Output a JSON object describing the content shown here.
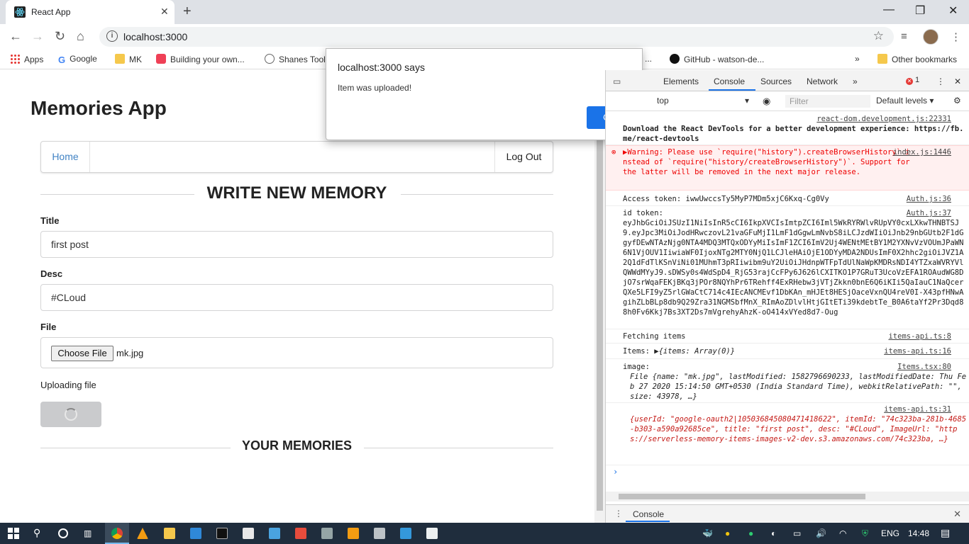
{
  "browser": {
    "tab_title": "React App",
    "url": "localhost:3000",
    "bookmarks": [
      "Apps",
      "Google",
      "MK",
      "Building your own...",
      "Shanes Tool",
      "...",
      "GitHub - watson-de...",
      "Other bookmarks"
    ]
  },
  "alert": {
    "title": "localhost:3000 says",
    "message": "Item was uploaded!",
    "ok_label": "OK"
  },
  "app": {
    "title": "Memories App",
    "menu": {
      "home": "Home",
      "logout": "Log Out"
    },
    "form_header": "WRITE NEW MEMORY",
    "title_label": "Title",
    "title_value": "first post",
    "desc_label": "Desc",
    "desc_value": "#CLoud",
    "file_label": "File",
    "file_button": "Choose File",
    "file_name": "mk.jpg",
    "status": "Uploading file",
    "memories_header": "YOUR MEMORIES"
  },
  "devtools": {
    "tabs": [
      "Elements",
      "Console",
      "Sources",
      "Network"
    ],
    "error_count": "1",
    "context": "top",
    "filter_placeholder": "Filter",
    "levels": "Default levels",
    "drawer_tab": "Console",
    "messages": {
      "m1_src": "react-dom.development.js:22331",
      "m1_text": "Download the React DevTools for a better development experience: https://fb.me/react-devtools",
      "m2_src": "index.js:1446",
      "m2_text": "▶Warning: Please use `require(\"history\").createBrowserHistory` instead of `require(\"history/createBrowserHistory\")`. Support for the latter will be removed in the next major release.",
      "m3_src": "Auth.js:36",
      "m3_text": "Access token:  iwwUwccsTy5MyP7MDm5xjC6Kxq-Cg0Vy",
      "m4_src": "Auth.js:37",
      "m4_label": "id token:",
      "m4_text": "eyJhbGciOiJSUzI1NiIsInR5cCI6IkpXVCIsImtpZCI6Iml5WkRYRWlvRUpVY0cxLXkwTHNBTSJ9.eyJpc3MiOiJodHRwczovL21vaGFuMjI1LmF1dGgwLmNvbS8iLCJzdWIiOiJnb29nbGUtb2F1dGgyfDEwNTAzNjg0NTA4MDQ3MTQxODYyMiIsImF1ZCI6ImV2Uj4WENtMEtBY1M2YXNvVzVOUmJPaWN6N1VjOUV1IiwiaWF0IjoxNTg2MTY0NjQ1LCJleHAiOjE1ODYyMDA2NDUsImF0X2hhc2giOiJVZ1A2Q1dFdTlKSnViNi01MUhmT3pRIiwibm9uY2UiOiJHdnpWTFpTdUlNaWpKMDRsNDI4YTZxaWVRYVlQWWdMYyJ9.sDWSy0s4WdSpD4_RjG53rajCcFPy6J626lCXITKO1P7GRuT3UcoVzEFA1ROAudWG8DjO7srWqaFEKjBKq3jPOr8NQYhPr6TRehff4ExRHebw3jVTjZkkn0bnE6Q6iKIi5QaIauC1NaQcerQXe5LFI9yZ5rlGWaCtC714c4IEcANCMEvf1DbKAn_mHJEt8HESjOaceVxnQU4reV0I-X43pfHNwAgihZLbBLp8db9Q29Zra31NGMSbfMnX_RImAoZDlvlHtjGItETi39kdebtTe_B0A6taYf2Pr3Dqd88h0Fv6Kkj7Bs3XT2Ds7mVgrehyAhzK-oO414xVYed8d7-Oug",
      "m5_src": "items-api.ts:8",
      "m5_text": "Fetching items",
      "m6_src": "items-api.ts:16",
      "m6_label": "Items: ",
      "m6_text": "▶{items: Array(0)}",
      "m7_src": "Items.tsx:80",
      "m7_label": "image:",
      "m7_text": "File {name: \"mk.jpg\", lastModified: 1582796690233, lastModifiedDate: Thu Feb 27 2020 15:14:50 GMT+0530 (India Standard Time), webkitRelativePath: \"\", size: 43978, …}",
      "m8_src": "items-api.ts:31",
      "m8_text": "{userId: \"google-oauth2|105036845080471418622\", itemId: \"74c323ba-281b-4685-b303-a590a92685ce\", title: \"first post\", desc: \"#CLoud\", ImageUrl: \"https://serverless-memory-items-images-v2-dev.s3.amazonaws.com/74c323ba, …}"
    }
  },
  "taskbar": {
    "language": "ENG",
    "time": "14:48"
  }
}
